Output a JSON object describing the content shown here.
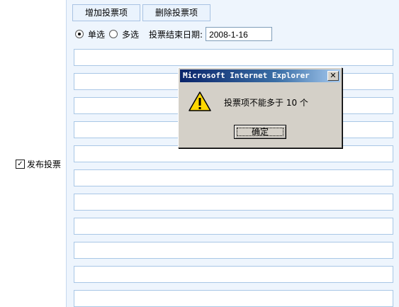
{
  "toolbar": {
    "add_label": "增加投票项",
    "delete_label": "删除投票项"
  },
  "options": {
    "single_label": "单选",
    "multi_label": "多选",
    "selected": "single",
    "end_date_label": "投票结束日期:",
    "end_date_value": "2008-1-16"
  },
  "publish": {
    "label": "发布投票",
    "checked": true
  },
  "vote_fields": [
    "",
    "",
    "",
    "",
    "",
    "",
    "",
    "",
    "",
    "",
    ""
  ],
  "dialog": {
    "title": "Microsoft Internet Explorer",
    "message": "投票项不能多于 10 个",
    "ok_label": "确定",
    "icon": "warning-icon"
  }
}
